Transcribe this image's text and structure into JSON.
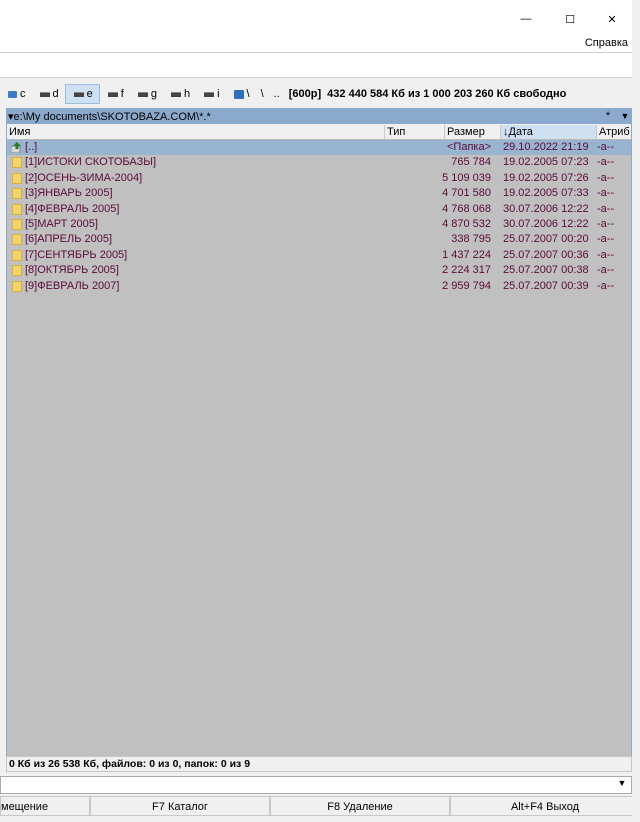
{
  "window": {
    "minimize_glyph": "—",
    "maximize_glyph": "☐",
    "close_glyph": "✕"
  },
  "menu": {
    "help": "Справка"
  },
  "drives": [
    {
      "letter": "c",
      "active": false
    },
    {
      "letter": "d",
      "active": false
    },
    {
      "letter": "e",
      "active": true
    },
    {
      "letter": "f",
      "active": false
    },
    {
      "letter": "g",
      "active": false
    },
    {
      "letter": "h",
      "active": false
    },
    {
      "letter": "i",
      "active": false
    }
  ],
  "drivebar": {
    "net_label": "\\",
    "root": "\\",
    "up": "..",
    "volume": "[600p]",
    "free_space": "432 440 584 Кб из 1 000 203 260 Кб свободно"
  },
  "path": {
    "text": "▾e:\\My documents\\SKOTOBAZA.COM\\*.*",
    "star": "*",
    "arrow": "▼"
  },
  "columns": {
    "name": "Имя",
    "type": "Тип",
    "size": "Размер",
    "date": "↓Дата",
    "attr": "Атриб"
  },
  "files": [
    {
      "name": "[..]",
      "size": "<Папка>",
      "date": "29.10.2022 21:19",
      "attr": "-a--",
      "up": true
    },
    {
      "name": "[1]ИСТОКИ СКОТОБАЗЫ]",
      "size": "765 784",
      "date": "19.02.2005 07:23",
      "attr": "-a--"
    },
    {
      "name": "[2]ОСЕНЬ-ЗИМА-2004]",
      "size": "5 109 039",
      "date": "19.02.2005 07:26",
      "attr": "-a--"
    },
    {
      "name": "[3]ЯНВАРЬ 2005]",
      "size": "4 701 580",
      "date": "19.02.2005 07:33",
      "attr": "-a--"
    },
    {
      "name": "[4]ФЕВРАЛЬ 2005]",
      "size": "4 768 068",
      "date": "30.07.2006 12:22",
      "attr": "-a--"
    },
    {
      "name": "[5]МАРТ 2005]",
      "size": "4 870 532",
      "date": "30.07.2006 12:22",
      "attr": "-a--"
    },
    {
      "name": "[6]АПРЕЛЬ 2005]",
      "size": "338 795",
      "date": "25.07.2007 00:20",
      "attr": "-a--"
    },
    {
      "name": "[7]СЕНТЯБРЬ 2005]",
      "size": "1 437 224",
      "date": "25.07.2007 00:36",
      "attr": "-a--"
    },
    {
      "name": "[8]ОКТЯБРЬ 2005]",
      "size": "2 224 317",
      "date": "25.07.2007 00:38",
      "attr": "-a--"
    },
    {
      "name": "[9]ФЕВРАЛЬ 2007]",
      "size": "2 959 794",
      "date": "25.07.2007 00:39",
      "attr": "-a--"
    }
  ],
  "status": "0 Кб из 26 538 Кб, файлов: 0 из 0, папок: 0 из 9",
  "fnkeys": [
    {
      "label": "мещение"
    },
    {
      "label": "F7 Каталог"
    },
    {
      "label": "F8 Удаление"
    },
    {
      "label": "Alt+F4 Выход"
    }
  ],
  "colors": {
    "selection": "#99b4d1",
    "panel_bg": "#c0c0c0",
    "file_text": "#5a0a3a",
    "folder": "#f5d36b"
  }
}
